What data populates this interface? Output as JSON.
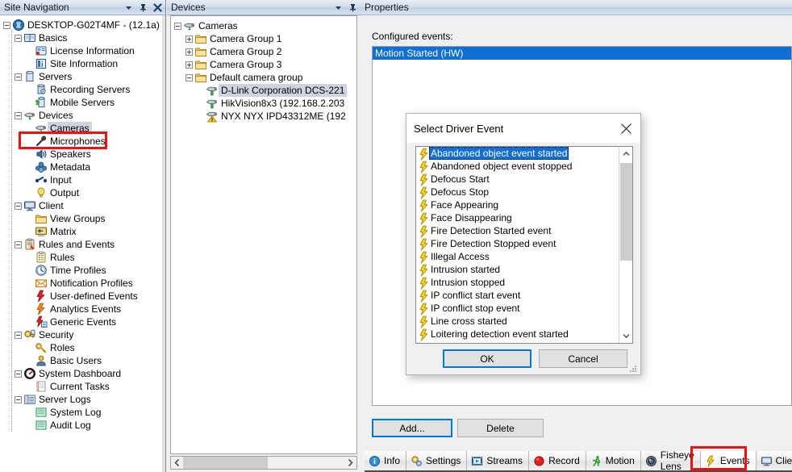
{
  "site_navigation": {
    "title": "Site Navigation",
    "header_buttons": [
      "dropdown-icon",
      "pin-icon",
      "close-icon"
    ],
    "tree": [
      {
        "label": "DESKTOP-G02T4MF - (12.1a)",
        "depth": 0,
        "icon": "site-server-icon",
        "expander": "minus"
      },
      {
        "label": "Basics",
        "depth": 1,
        "icon": "book-icon",
        "expander": "minus"
      },
      {
        "label": "License Information",
        "depth": 2,
        "icon": "license-icon",
        "expander": "none"
      },
      {
        "label": "Site Information",
        "depth": 2,
        "icon": "info-card-icon",
        "expander": "none"
      },
      {
        "label": "Servers",
        "depth": 1,
        "icon": "server-icon",
        "expander": "minus"
      },
      {
        "label": "Recording Servers",
        "depth": 2,
        "icon": "recording-server-icon",
        "expander": "none"
      },
      {
        "label": "Mobile Servers",
        "depth": 2,
        "icon": "mobile-server-icon",
        "expander": "none"
      },
      {
        "label": "Devices",
        "depth": 1,
        "icon": "camera-icon",
        "expander": "minus"
      },
      {
        "label": "Cameras",
        "depth": 2,
        "icon": "camera-icon",
        "expander": "none",
        "selected": true,
        "highlighted": true
      },
      {
        "label": "Microphones",
        "depth": 2,
        "icon": "microphone-icon",
        "expander": "none"
      },
      {
        "label": "Speakers",
        "depth": 2,
        "icon": "speaker-icon",
        "expander": "none"
      },
      {
        "label": "Metadata",
        "depth": 2,
        "icon": "metadata-icon",
        "expander": "none"
      },
      {
        "label": "Input",
        "depth": 2,
        "icon": "input-icon",
        "expander": "none"
      },
      {
        "label": "Output",
        "depth": 2,
        "icon": "output-bulb-icon",
        "expander": "none"
      },
      {
        "label": "Client",
        "depth": 1,
        "icon": "monitor-icon",
        "expander": "minus"
      },
      {
        "label": "View Groups",
        "depth": 2,
        "icon": "folder-icon",
        "expander": "none"
      },
      {
        "label": "Matrix",
        "depth": 2,
        "icon": "matrix-icon",
        "expander": "none"
      },
      {
        "label": "Rules and Events",
        "depth": 1,
        "icon": "rules-clipboard-icon",
        "expander": "minus"
      },
      {
        "label": "Rules",
        "depth": 2,
        "icon": "rules-list-icon",
        "expander": "none"
      },
      {
        "label": "Time Profiles",
        "depth": 2,
        "icon": "clock-icon",
        "expander": "none"
      },
      {
        "label": "Notification Profiles",
        "depth": 2,
        "icon": "envelope-icon",
        "expander": "none"
      },
      {
        "label": "User-defined Events",
        "depth": 2,
        "icon": "bolt-red-icon",
        "expander": "none"
      },
      {
        "label": "Analytics Events",
        "depth": 2,
        "icon": "bolt-orange-icon",
        "expander": "none"
      },
      {
        "label": "Generic Events",
        "depth": 2,
        "icon": "bolt-generic-icon",
        "expander": "none"
      },
      {
        "label": "Security",
        "depth": 1,
        "icon": "lock-key-icon",
        "expander": "minus"
      },
      {
        "label": "Roles",
        "depth": 2,
        "icon": "key-icon",
        "expander": "none"
      },
      {
        "label": "Basic Users",
        "depth": 2,
        "icon": "user-icon",
        "expander": "none"
      },
      {
        "label": "System Dashboard",
        "depth": 1,
        "icon": "dashboard-gauge-icon",
        "expander": "minus"
      },
      {
        "label": "Current Tasks",
        "depth": 2,
        "icon": "tasks-icon",
        "expander": "none"
      },
      {
        "label": "Server Logs",
        "depth": 1,
        "icon": "logs-icon",
        "expander": "minus"
      },
      {
        "label": "System Log",
        "depth": 2,
        "icon": "log-grid-icon",
        "expander": "none"
      },
      {
        "label": "Audit Log",
        "depth": 2,
        "icon": "log-grid-icon",
        "expander": "none"
      }
    ]
  },
  "devices": {
    "title": "Devices",
    "header_buttons": [
      "dropdown-icon",
      "pin-icon"
    ],
    "tree": [
      {
        "label": "Cameras",
        "depth": 0,
        "icon": "camera-icon",
        "expander": "minus"
      },
      {
        "label": "Camera Group 1",
        "depth": 1,
        "icon": "folder-icon",
        "expander": "plus"
      },
      {
        "label": "Camera Group 2",
        "depth": 1,
        "icon": "folder-icon",
        "expander": "plus"
      },
      {
        "label": "Camera Group 3",
        "depth": 1,
        "icon": "folder-icon",
        "expander": "plus"
      },
      {
        "label": "Default camera group",
        "depth": 1,
        "icon": "folder-icon",
        "expander": "minus"
      },
      {
        "label": "D-Link Corporation DCS-221",
        "depth": 2,
        "icon": "camera-device-icon",
        "expander": "none",
        "selected": true
      },
      {
        "label": "HikVision8x3 (192.168.2.203",
        "depth": 2,
        "icon": "camera-device-icon",
        "expander": "none"
      },
      {
        "label": "NYX NYX IPD43312ME (192",
        "depth": 2,
        "icon": "camera-device-warning-icon",
        "expander": "none"
      }
    ],
    "hscroll": {
      "left_arrow": "chevron-left-icon",
      "right_arrow": "chevron-right-icon"
    }
  },
  "properties": {
    "title": "Properties",
    "configured_events_label": "Configured events:",
    "configured_events": [
      {
        "label": "Motion Started (HW)",
        "selected": true
      }
    ],
    "add_button": "Add...",
    "delete_button": "Delete",
    "tabs": [
      {
        "label": "Info",
        "icon": "info-icon",
        "active": false
      },
      {
        "label": "Settings",
        "icon": "settings-gears-icon",
        "active": false
      },
      {
        "label": "Streams",
        "icon": "streams-film-icon",
        "active": false
      },
      {
        "label": "Record",
        "icon": "record-dot-icon",
        "active": false
      },
      {
        "label": "Motion",
        "icon": "motion-runner-icon",
        "active": false
      },
      {
        "label": "Fisheye Lens",
        "icon": "fisheye-lens-icon",
        "active": false
      },
      {
        "label": "Events",
        "icon": "bolt-yellow-icon",
        "active": true,
        "highlighted": true
      },
      {
        "label": "Client",
        "icon": "client-monitor-icon",
        "active": false
      }
    ]
  },
  "dialog": {
    "title": "Select Driver Event",
    "close_icon": "close-icon",
    "events": [
      {
        "label": "Abandoned object event started",
        "selected": true
      },
      {
        "label": "Abandoned object event stopped",
        "selected": false
      },
      {
        "label": "Defocus Start",
        "selected": false
      },
      {
        "label": "Defocus Stop",
        "selected": false
      },
      {
        "label": "Face Appearing",
        "selected": false
      },
      {
        "label": "Face Disappearing",
        "selected": false
      },
      {
        "label": "Fire Detection Started event",
        "selected": false
      },
      {
        "label": "Fire Detection Stopped event",
        "selected": false
      },
      {
        "label": "Illegal Access",
        "selected": false
      },
      {
        "label": "Intrusion started",
        "selected": false
      },
      {
        "label": "Intrusion stopped",
        "selected": false
      },
      {
        "label": "IP conflict start event",
        "selected": false
      },
      {
        "label": "IP conflict stop event",
        "selected": false
      },
      {
        "label": "Line cross started",
        "selected": false
      },
      {
        "label": "Loitering detection event started",
        "selected": false
      }
    ],
    "scroll_up_icon": "chevron-up-icon",
    "scroll_down_icon": "chevron-down-icon",
    "ok_button": "OK",
    "cancel_button": "Cancel"
  },
  "colors": {
    "selection_blue": "#0f6fd4",
    "annotation_red": "#ee1111",
    "default_button_border": "#0078d7",
    "panel_header_blue": "#cfdced"
  }
}
